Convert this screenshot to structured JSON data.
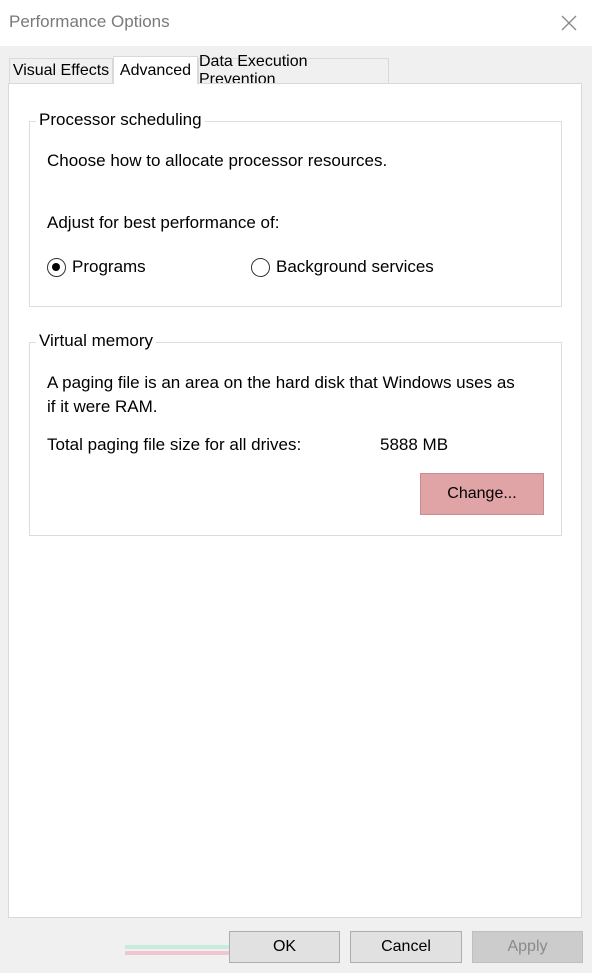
{
  "window": {
    "title": "Performance Options"
  },
  "tabs": [
    {
      "label": "Visual Effects",
      "active": false
    },
    {
      "label": "Advanced",
      "active": true
    },
    {
      "label": "Data Execution Prevention",
      "active": false
    }
  ],
  "processor": {
    "legend": "Processor scheduling",
    "description": "Choose how to allocate processor resources.",
    "adjust_label": "Adjust for best performance of:",
    "options": [
      {
        "label": "Programs",
        "selected": true
      },
      {
        "label": "Background services",
        "selected": false
      }
    ]
  },
  "virtual_memory": {
    "legend": "Virtual memory",
    "description_line1": "A paging file is an area on the hard disk that Windows uses as",
    "description_line2": "if it were RAM.",
    "total_label": "Total paging file size for all drives:",
    "total_value": "5888 MB",
    "change_button": "Change..."
  },
  "footer": {
    "ok": "OK",
    "cancel": "Cancel",
    "apply": "Apply"
  },
  "colors": {
    "change_button_bg": "#e0a3a6",
    "window_bg": "#f0f0f0",
    "ghost_text": "#c6d3ef"
  }
}
